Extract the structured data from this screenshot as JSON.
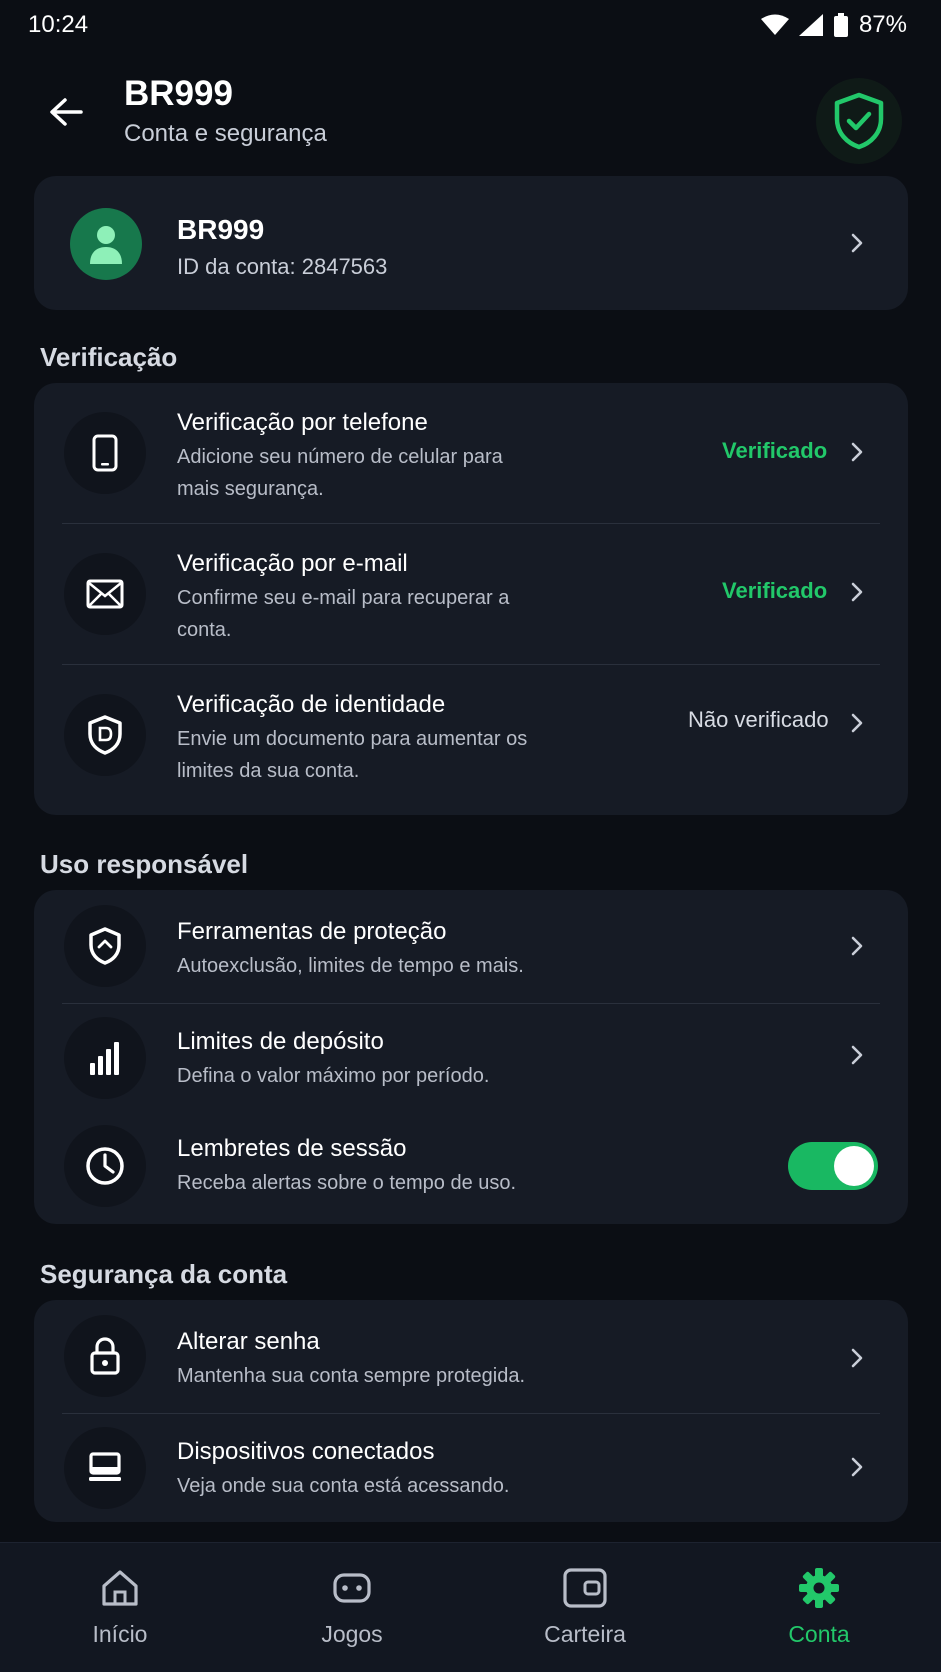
{
  "status_bar": {
    "time": "10:24",
    "battery": "87%"
  },
  "header": {
    "title": "BR999",
    "subtitle": "Conta e segurança"
  },
  "profile": {
    "name": "BR999",
    "account_id": "ID da conta: 2847563"
  },
  "sections": {
    "verification": {
      "title": "Verificação",
      "items": [
        {
          "title": "Verificação por telefone",
          "desc": "Adicione seu número de celular para mais segurança.",
          "status": "Verificado",
          "icon": "smartphone-icon"
        },
        {
          "title": "Verificação por e-mail",
          "desc": "Confirme seu e-mail para recuperar a conta.",
          "status": "Verificado",
          "icon": "envelope-icon"
        },
        {
          "title": "Verificação de identidade",
          "desc": "Envie um documento para aumentar os limites da sua conta.",
          "status": "Não verificado",
          "icon": "shield-document-icon"
        }
      ]
    },
    "responsible": {
      "title": "Uso responsável",
      "items": [
        {
          "title": "Ferramentas de proteção",
          "desc": "Autoexclusão, limites de tempo e mais.",
          "icon": "shield-icon"
        },
        {
          "title": "Limites de depósito",
          "desc": "Defina o valor máximo por período.",
          "icon": "signal-bars-icon"
        },
        {
          "title": "Lembretes de sessão",
          "desc": "Receba alertas sobre o tempo de uso.",
          "icon": "clock-icon",
          "toggle_on": true
        }
      ]
    },
    "security": {
      "title": "Segurança da conta",
      "items": [
        {
          "title": "Alterar senha",
          "desc": "Mantenha sua conta sempre protegida.",
          "icon": "lock-icon"
        },
        {
          "title": "Dispositivos conectados",
          "desc": "Veja onde sua conta está acessando.",
          "icon": "laptop-icon"
        }
      ]
    }
  },
  "bottom_nav": [
    {
      "label": "Início",
      "icon": "home-icon"
    },
    {
      "label": "Jogos",
      "icon": "gamepad-icon"
    },
    {
      "label": "Carteira",
      "icon": "wallet-icon"
    },
    {
      "label": "Conta",
      "icon": "gear-icon",
      "active": true
    }
  ],
  "colors": {
    "background": "#0b0e14",
    "card": "#161b25",
    "accent": "#22c86a",
    "muted_text": "#b8bdc8"
  }
}
